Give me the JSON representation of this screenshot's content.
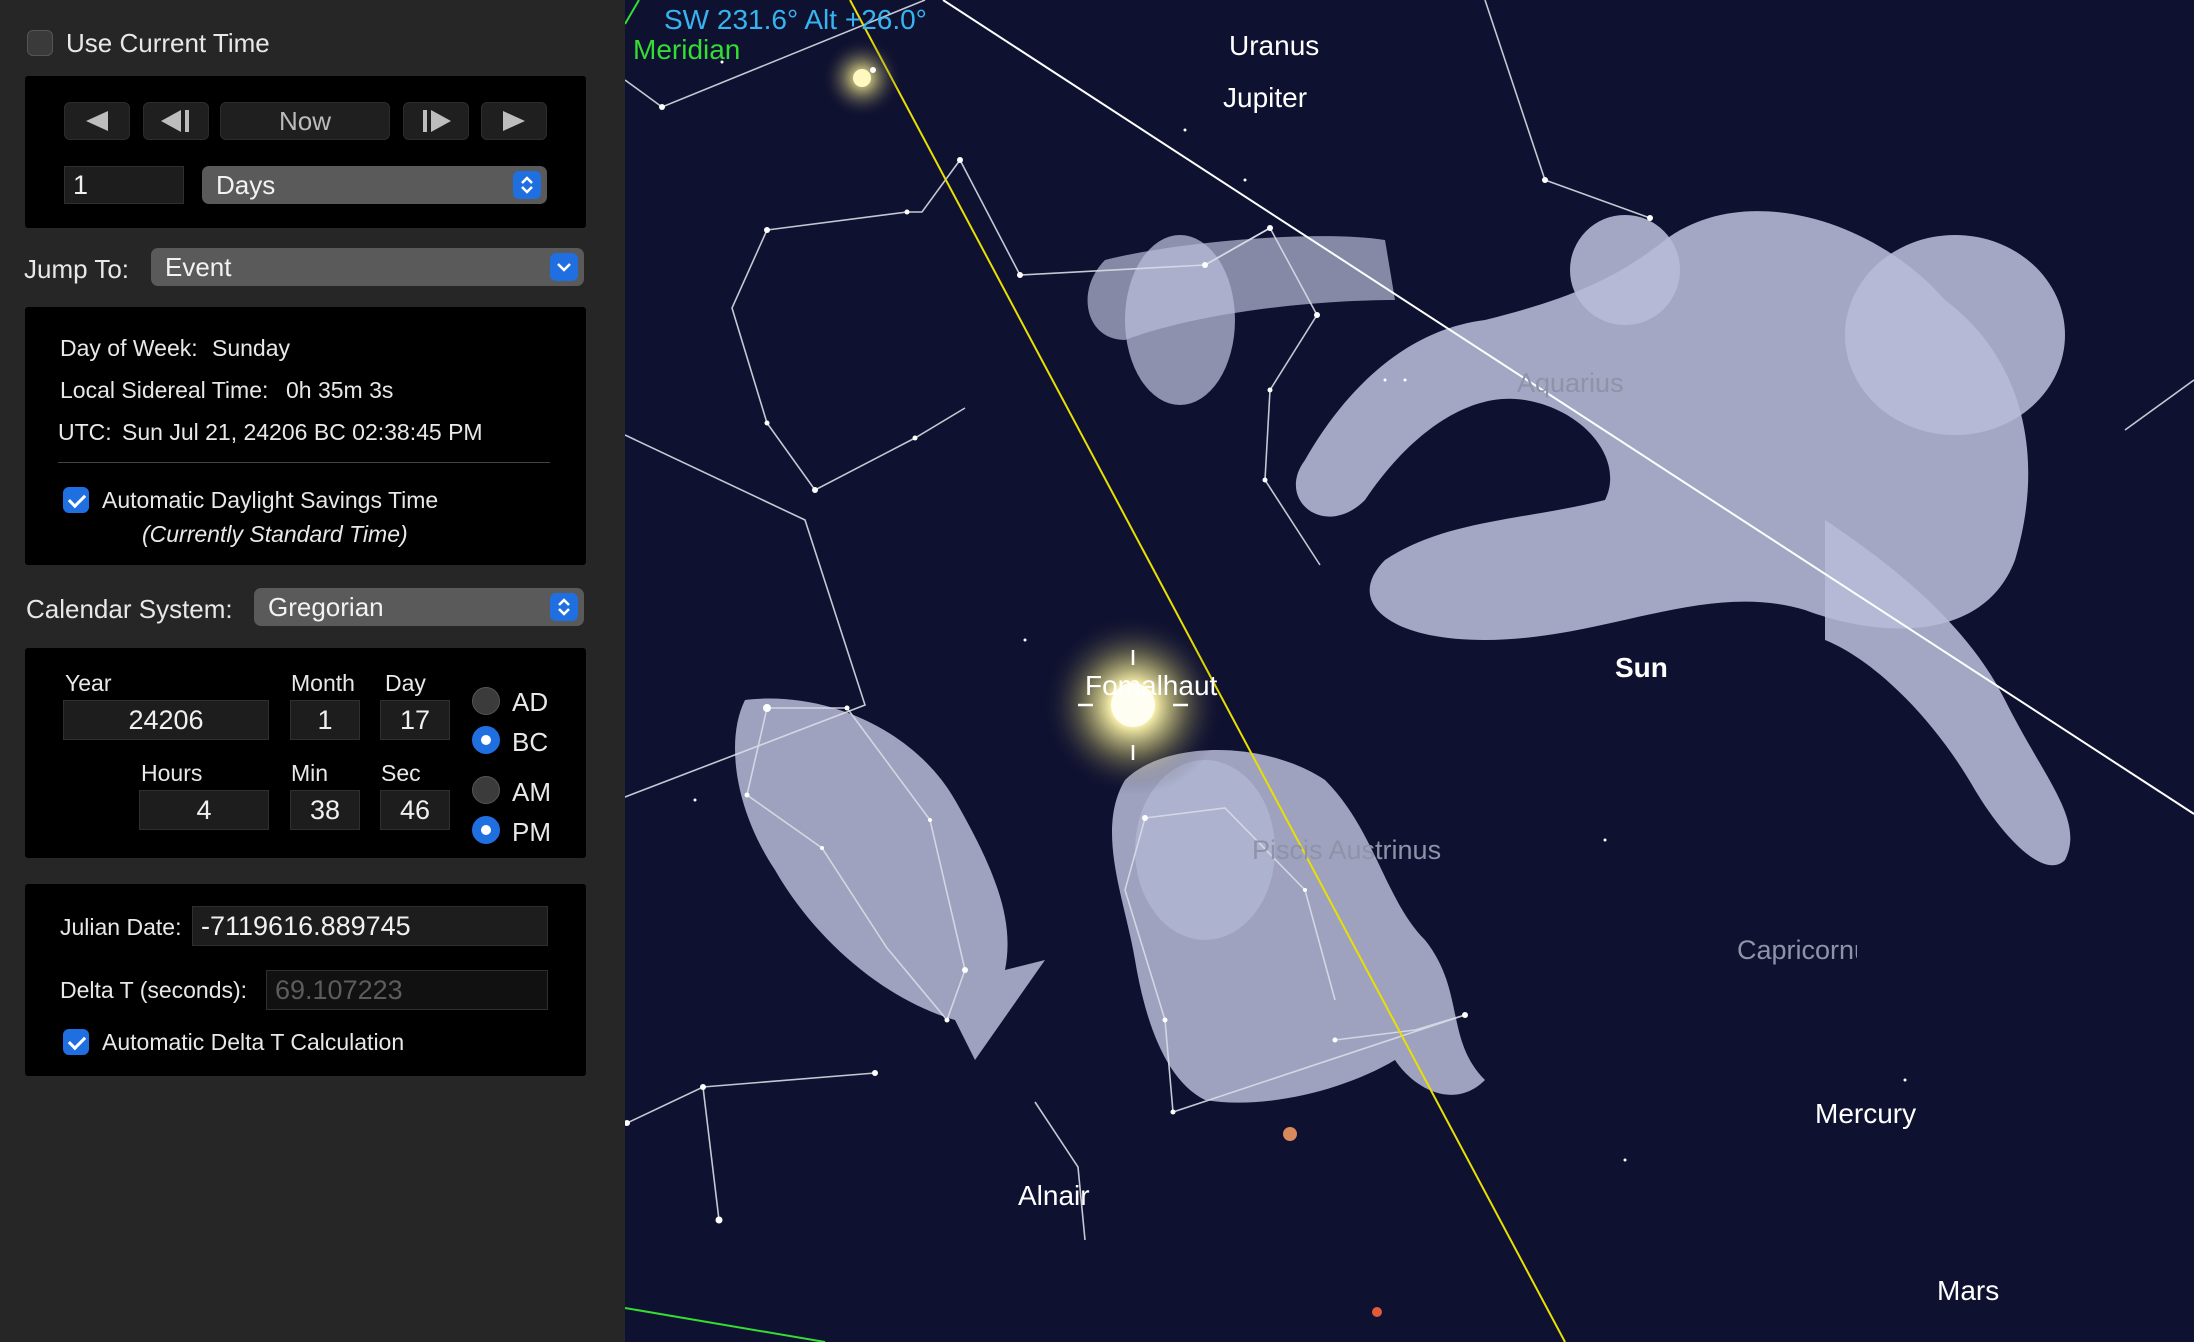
{
  "time_panel": {
    "use_current_time": {
      "label": "Use Current Time",
      "checked": false
    },
    "now_button": "Now",
    "step_value": "1",
    "step_unit": "Days",
    "jump_to": {
      "label": "Jump To:",
      "value": "Event"
    },
    "info": {
      "day_of_week_label": "Day of Week:",
      "day_of_week": "Sunday",
      "sidereal_label": "Local Sidereal Time:",
      "sidereal": "0h 35m 3s",
      "utc_label": "UTC:",
      "utc": "Sun Jul 21, 24206 BC 02:38:45 PM",
      "dst_label": "Automatic Daylight Savings Time",
      "dst_checked": true,
      "dst_status": "(Currently Standard Time)"
    },
    "calendar": {
      "label": "Calendar System:",
      "value": "Gregorian"
    },
    "date": {
      "year_label": "Year",
      "year": "24206",
      "month_label": "Month",
      "month": "1",
      "day_label": "Day",
      "day": "17",
      "hours_label": "Hours",
      "hours": "4",
      "min_label": "Min",
      "min": "38",
      "sec_label": "Sec",
      "sec": "46",
      "era_ad": "AD",
      "era_bc": "BC",
      "era_selected": "BC",
      "ampm_am": "AM",
      "ampm_pm": "PM",
      "ampm_selected": "PM"
    },
    "julian": {
      "label": "Julian Date:",
      "value": "-7119616.889745",
      "delta_t_label": "Delta T (seconds):",
      "delta_t": "69.107223",
      "auto_delta_label": "Automatic Delta T Calculation",
      "auto_delta_checked": true
    }
  },
  "sky": {
    "direction_readout": "SW 231.6° Alt +26.0°",
    "meridian_label": "Meridian",
    "objects": {
      "uranus": "Uranus",
      "jupiter": "Jupiter",
      "sun": "Sun",
      "fomalhaut": "Fomalhaut",
      "mercury": "Mercury",
      "alnair": "Alnair",
      "mars": "Mars"
    },
    "constellations": {
      "aquarius": "Aquarius",
      "piscis_austrinus": "Piscis Austrinus",
      "capricornus": "Capricornus"
    },
    "colors": {
      "sky_background": "#0f1130",
      "ecliptic": "#e8e000",
      "meridian": "#33dd33",
      "readout": "#37b4f0",
      "accent": "#1f6fe0"
    }
  }
}
